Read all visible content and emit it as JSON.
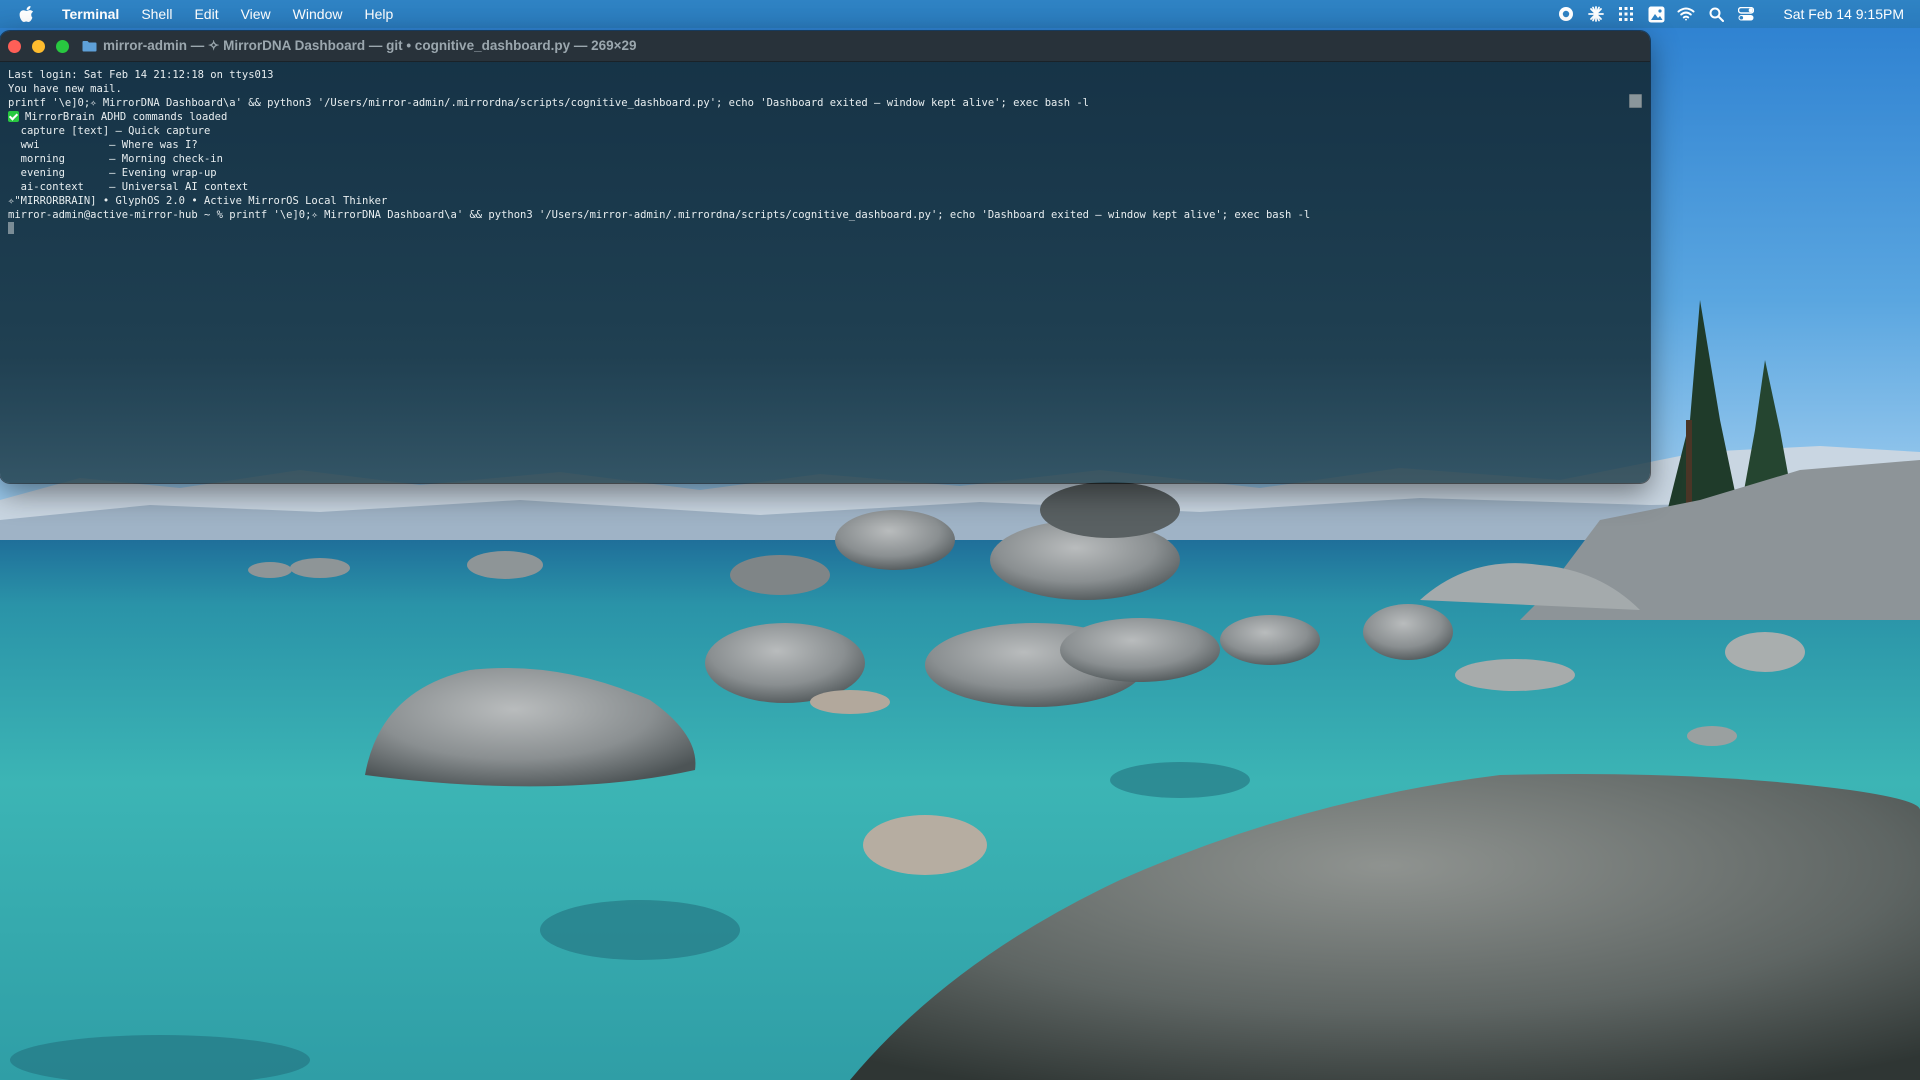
{
  "menubar": {
    "apple_icon": "apple-logo-icon",
    "app_name": "Terminal",
    "items": [
      "Shell",
      "Edit",
      "View",
      "Window",
      "Help"
    ],
    "status_icons": [
      "screen-record-icon",
      "claude-asterisk-icon",
      "grid-icon",
      "photo-icon",
      "wifi-icon",
      "search-icon",
      "control-center-icon"
    ],
    "clock": "Sat Feb 14  9:15PM"
  },
  "terminal": {
    "title": "mirror-admin — ✧ MirrorDNA Dashboard — git • cognitive_dashboard.py — 269×29",
    "lines": [
      "Last login: Sat Feb 14 21:12:18 on ttys013",
      "You have new mail.",
      "printf '\\e]0;✧ MirrorDNA Dashboard\\a' && python3 '/Users/mirror-admin/.mirrordna/scripts/cognitive_dashboard.py'; echo 'Dashboard exited – window kept alive'; exec bash -l",
      "MirrorBrain ADHD commands loaded",
      "  capture [text] – Quick capture",
      "  wwi           – Where was I?",
      "  morning       – Morning check-in",
      "  evening       – Evening wrap-up",
      "  ai-context    – Universal AI context",
      "✧\"MIRRORBRAIN] • GlyphOS 2.0 • Active MirrorOS Local Thinker",
      "mirror-admin@active-mirror-hub ~ % printf '\\e]0;✧ MirrorDNA Dashboard\\a' && python3 '/Users/mirror-admin/.mirrordna/scripts/cognitive_dashboard.py'; echo 'Dashboard exited – window kept alive'; exec bash -l"
    ]
  },
  "colors": {
    "menubar": "#2f83c4",
    "terminal_bg": "#162f3e",
    "close": "#fe5f57",
    "minimize": "#febc2e",
    "maximize": "#28c840"
  }
}
